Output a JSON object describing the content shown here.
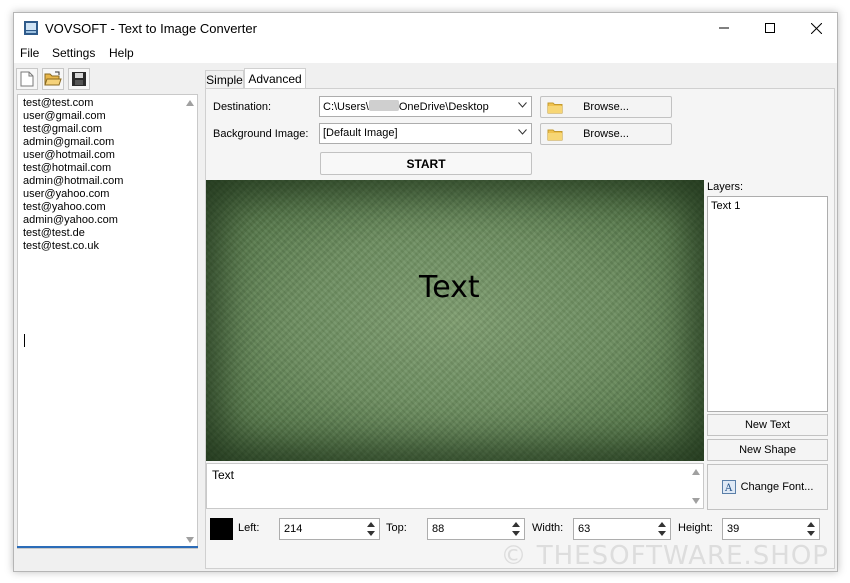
{
  "window": {
    "title": "VOVSOFT - Text to Image Converter"
  },
  "menu": {
    "file": "File",
    "settings": "Settings",
    "help": "Help"
  },
  "toolbar": {
    "new_icon": "new-file-icon",
    "open_icon": "open-folder-icon",
    "save_icon": "save-disk-icon"
  },
  "left_list": {
    "lines": [
      "test@test.com",
      "user@gmail.com",
      "test@gmail.com",
      "admin@gmail.com",
      "user@hotmail.com",
      "test@hotmail.com",
      "admin@hotmail.com",
      "user@yahoo.com",
      "test@yahoo.com",
      "admin@yahoo.com",
      "test@test.de",
      "test@test.co.uk"
    ]
  },
  "tabs": {
    "simple": "Simple",
    "advanced": "Advanced",
    "active": "Advanced"
  },
  "form": {
    "destination_label": "Destination:",
    "destination_prefix": "C:\\Users\\",
    "destination_suffix": "OneDrive\\Desktop",
    "background_label": "Background Image:",
    "background_value": "[Default Image]",
    "browse_label": "Browse...",
    "start_label": "START"
  },
  "canvas": {
    "text": "Text"
  },
  "layers": {
    "label": "Layers:",
    "items": [
      "Text 1"
    ],
    "new_text": "New Text",
    "new_shape": "New Shape",
    "change_font": "Change Font..."
  },
  "editor": {
    "text": "Text"
  },
  "position": {
    "left_label": "Left:",
    "left_value": "214",
    "top_label": "Top:",
    "top_value": "88",
    "width_label": "Width:",
    "width_value": "63",
    "height_label": "Height:",
    "height_value": "39",
    "color": "#000000"
  },
  "watermark": "© THESOFTWARE.SHOP",
  "colors": {
    "accent": "#2b6cb8",
    "canvas_green": "#6d8e60"
  }
}
